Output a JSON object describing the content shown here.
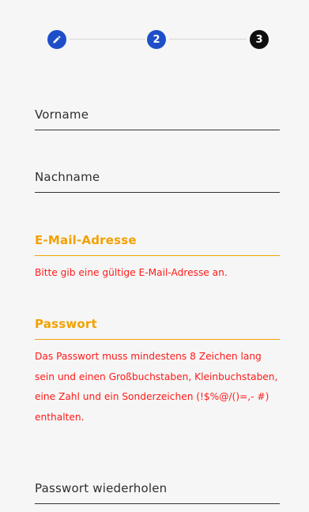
{
  "stepper": {
    "steps": [
      {
        "label": "",
        "icon": "pencil-icon",
        "state": "done"
      },
      {
        "label": "2",
        "state": "active"
      },
      {
        "label": "3",
        "state": "upcoming"
      }
    ]
  },
  "form": {
    "first_name": {
      "placeholder": "Vorname"
    },
    "last_name": {
      "placeholder": "Nachname"
    },
    "email": {
      "label": "E-Mail-Adresse",
      "error": "Bitte gib eine gültige E-Mail-Adresse an."
    },
    "password": {
      "label": "Passwort",
      "error": "Das Passwort muss mindestens 8 Zeichen lang sein und einen Großbuchstaben, Kleinbuchstaben, eine Zahl und ein Sonderzeichen (!$%@/()=,- #) enthalten."
    },
    "password_repeat": {
      "placeholder": "Passwort wiederholen"
    }
  },
  "colors": {
    "active_step": "#1e4fc9",
    "upcoming_step": "#0f0f0f",
    "error_label": "#f2a100",
    "error_text": "#ff1a1a"
  }
}
